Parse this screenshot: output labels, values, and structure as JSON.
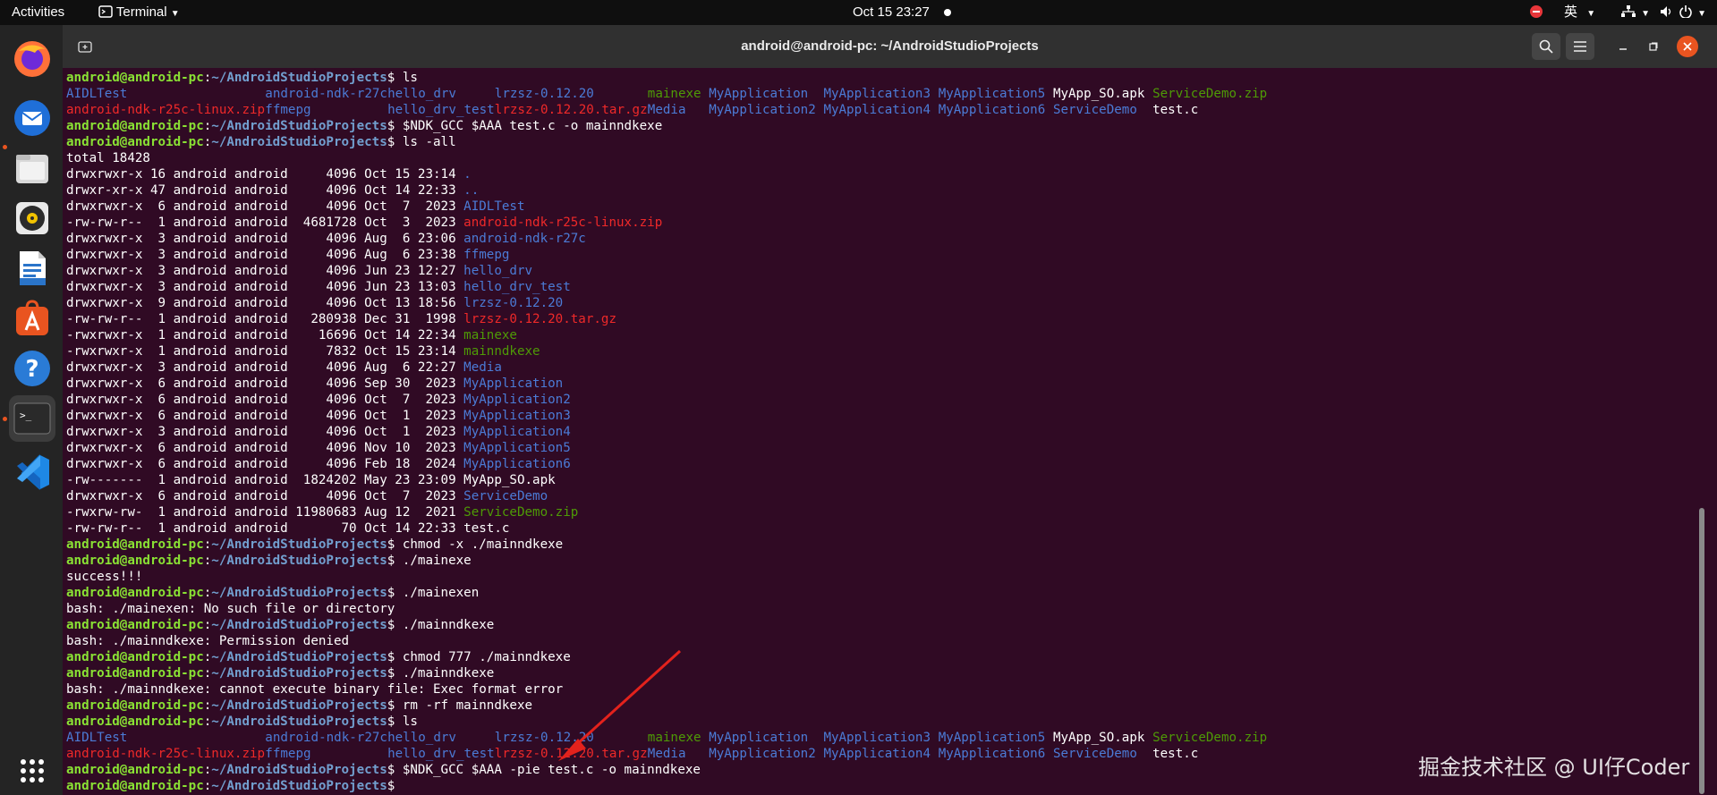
{
  "topbar": {
    "activities": "Activities",
    "app_menu": "Terminal",
    "clock": "Oct 15  23:27",
    "input_method": "英"
  },
  "window": {
    "title": "android@android-pc: ~/AndroidStudioProjects"
  },
  "prompt": {
    "user_host": "android@android-pc",
    "sep": ":",
    "path": "~/AndroidStudioProjects",
    "dollar": "$"
  },
  "terminal_lines": [
    {
      "type": "prompt",
      "cmd": " ls"
    },
    {
      "type": "grid",
      "cells": [
        {
          "t": "AIDLTest",
          "c": "dir"
        },
        {
          "t": "android-ndk-r27c",
          "c": "dir"
        },
        {
          "t": "hello_drv",
          "c": "dir"
        },
        {
          "t": "lrzsz-0.12.20",
          "c": "dir"
        },
        {
          "t": "mainexe",
          "c": "ex"
        },
        {
          "t": "MyApplication",
          "c": "dir"
        },
        {
          "t": "MyApplication3",
          "c": "dir"
        },
        {
          "t": "MyApplication5",
          "c": "dir"
        },
        {
          "t": "MyApp_SO.apk",
          "c": "plain"
        },
        {
          "t": "ServiceDemo.zip",
          "c": "ex"
        }
      ]
    },
    {
      "type": "grid",
      "cells": [
        {
          "t": "android-ndk-r25c-linux.zip",
          "c": "ar"
        },
        {
          "t": "ffmepg",
          "c": "dir"
        },
        {
          "t": "hello_drv_test",
          "c": "dir"
        },
        {
          "t": "lrzsz-0.12.20.tar.gz",
          "c": "ar"
        },
        {
          "t": "Media",
          "c": "dir"
        },
        {
          "t": "MyApplication2",
          "c": "dir"
        },
        {
          "t": "MyApplication4",
          "c": "dir"
        },
        {
          "t": "MyApplication6",
          "c": "dir"
        },
        {
          "t": "ServiceDemo",
          "c": "dir"
        },
        {
          "t": "test.c",
          "c": "plain"
        }
      ]
    },
    {
      "type": "prompt",
      "cmd": " $NDK_GCC $AAA test.c -o mainndkexe"
    },
    {
      "type": "prompt",
      "cmd": " ls -all"
    },
    {
      "type": "text",
      "text": "total 18428"
    },
    {
      "type": "ls",
      "pre": "drwxrwxr-x 16 android android     4096 Oct 15 23:14 ",
      "name": ".",
      "c": "dir"
    },
    {
      "type": "ls",
      "pre": "drwxr-xr-x 47 android android     4096 Oct 14 22:33 ",
      "name": "..",
      "c": "dir"
    },
    {
      "type": "ls",
      "pre": "drwxrwxr-x  6 android android     4096 Oct  7  2023 ",
      "name": "AIDLTest",
      "c": "dir"
    },
    {
      "type": "ls",
      "pre": "-rw-rw-r--  1 android android  4681728 Oct  3  2023 ",
      "name": "android-ndk-r25c-linux.zip",
      "c": "ar"
    },
    {
      "type": "ls",
      "pre": "drwxrwxr-x  3 android android     4096 Aug  6 23:06 ",
      "name": "android-ndk-r27c",
      "c": "dir"
    },
    {
      "type": "ls",
      "pre": "drwxrwxr-x  3 android android     4096 Aug  6 23:38 ",
      "name": "ffmepg",
      "c": "dir"
    },
    {
      "type": "ls",
      "pre": "drwxrwxr-x  3 android android     4096 Jun 23 12:27 ",
      "name": "hello_drv",
      "c": "dir"
    },
    {
      "type": "ls",
      "pre": "drwxrwxr-x  3 android android     4096 Jun 23 13:03 ",
      "name": "hello_drv_test",
      "c": "dir"
    },
    {
      "type": "ls",
      "pre": "drwxrwxr-x  9 android android     4096 Oct 13 18:56 ",
      "name": "lrzsz-0.12.20",
      "c": "dir"
    },
    {
      "type": "ls",
      "pre": "-rw-rw-r--  1 android android   280938 Dec 31  1998 ",
      "name": "lrzsz-0.12.20.tar.gz",
      "c": "ar"
    },
    {
      "type": "ls",
      "pre": "-rwxrwxr-x  1 android android    16696 Oct 14 22:34 ",
      "name": "mainexe",
      "c": "ex"
    },
    {
      "type": "ls",
      "pre": "-rwxrwxr-x  1 android android     7832 Oct 15 23:14 ",
      "name": "mainndkexe",
      "c": "ex"
    },
    {
      "type": "ls",
      "pre": "drwxrwxr-x  3 android android     4096 Aug  6 22:27 ",
      "name": "Media",
      "c": "dir"
    },
    {
      "type": "ls",
      "pre": "drwxrwxr-x  6 android android     4096 Sep 30  2023 ",
      "name": "MyApplication",
      "c": "dir"
    },
    {
      "type": "ls",
      "pre": "drwxrwxr-x  6 android android     4096 Oct  7  2023 ",
      "name": "MyApplication2",
      "c": "dir"
    },
    {
      "type": "ls",
      "pre": "drwxrwxr-x  6 android android     4096 Oct  1  2023 ",
      "name": "MyApplication3",
      "c": "dir"
    },
    {
      "type": "ls",
      "pre": "drwxrwxr-x  3 android android     4096 Oct  1  2023 ",
      "name": "MyApplication4",
      "c": "dir"
    },
    {
      "type": "ls",
      "pre": "drwxrwxr-x  6 android android     4096 Nov 10  2023 ",
      "name": "MyApplication5",
      "c": "dir"
    },
    {
      "type": "ls",
      "pre": "drwxrwxr-x  6 android android     4096 Feb 18  2024 ",
      "name": "MyApplication6",
      "c": "dir"
    },
    {
      "type": "ls",
      "pre": "-rw-------  1 android android  1824202 May 23 23:09 ",
      "name": "MyApp_SO.apk",
      "c": "plain"
    },
    {
      "type": "ls",
      "pre": "drwxrwxr-x  6 android android     4096 Oct  7  2023 ",
      "name": "ServiceDemo",
      "c": "dir"
    },
    {
      "type": "ls",
      "pre": "-rwxrw-rw-  1 android android 11980683 Aug 12  2021 ",
      "name": "ServiceDemo.zip",
      "c": "ex"
    },
    {
      "type": "ls",
      "pre": "-rw-rw-r--  1 android android       70 Oct 14 22:33 ",
      "name": "test.c",
      "c": "plain"
    },
    {
      "type": "prompt",
      "cmd": " chmod -x ./mainndkexe"
    },
    {
      "type": "prompt",
      "cmd": " ./mainexe"
    },
    {
      "type": "text",
      "text": "success!!!"
    },
    {
      "type": "prompt",
      "cmd": " ./mainexen"
    },
    {
      "type": "text",
      "text": "bash: ./mainexen: No such file or directory"
    },
    {
      "type": "prompt",
      "cmd": " ./mainndkexe"
    },
    {
      "type": "text",
      "text": "bash: ./mainndkexe: Permission denied"
    },
    {
      "type": "prompt",
      "cmd": " chmod 777 ./mainndkexe"
    },
    {
      "type": "prompt",
      "cmd": " ./mainndkexe"
    },
    {
      "type": "text",
      "text": "bash: ./mainndkexe: cannot execute binary file: Exec format error"
    },
    {
      "type": "prompt",
      "cmd": " rm -rf mainndkexe"
    },
    {
      "type": "prompt",
      "cmd": " ls"
    },
    {
      "type": "grid",
      "cells": [
        {
          "t": "AIDLTest",
          "c": "dir"
        },
        {
          "t": "android-ndk-r27c",
          "c": "dir"
        },
        {
          "t": "hello_drv",
          "c": "dir"
        },
        {
          "t": "lrzsz-0.12.20",
          "c": "dir"
        },
        {
          "t": "mainexe",
          "c": "ex"
        },
        {
          "t": "MyApplication",
          "c": "dir"
        },
        {
          "t": "MyApplication3",
          "c": "dir"
        },
        {
          "t": "MyApplication5",
          "c": "dir"
        },
        {
          "t": "MyApp_SO.apk",
          "c": "plain"
        },
        {
          "t": "ServiceDemo.zip",
          "c": "ex"
        }
      ]
    },
    {
      "type": "grid",
      "cells": [
        {
          "t": "android-ndk-r25c-linux.zip",
          "c": "ar"
        },
        {
          "t": "ffmepg",
          "c": "dir"
        },
        {
          "t": "hello_drv_test",
          "c": "dir"
        },
        {
          "t": "lrzsz-0.12.20.tar.gz",
          "c": "ar"
        },
        {
          "t": "Media",
          "c": "dir"
        },
        {
          "t": "MyApplication2",
          "c": "dir"
        },
        {
          "t": "MyApplication4",
          "c": "dir"
        },
        {
          "t": "MyApplication6",
          "c": "dir"
        },
        {
          "t": "ServiceDemo",
          "c": "dir"
        },
        {
          "t": "test.c",
          "c": "plain"
        }
      ]
    },
    {
      "type": "prompt",
      "cmd": " $NDK_GCC $AAA -pie test.c -o mainndkexe"
    },
    {
      "type": "prompt",
      "cmd": ""
    }
  ],
  "watermark": "掘金技术社区 @ UI仔Coder",
  "dock_apps": [
    {
      "name": "firefox-icon"
    },
    {
      "name": "thunderbird-icon"
    },
    {
      "name": "files-icon"
    },
    {
      "name": "rhythmbox-icon"
    },
    {
      "name": "writer-icon"
    },
    {
      "name": "app-center-icon"
    },
    {
      "name": "help-icon"
    },
    {
      "name": "terminal-icon"
    },
    {
      "name": "vscode-icon"
    }
  ],
  "colors": {
    "prompt_user": "#8ae234",
    "prompt_path": "#729fcf",
    "directory": "#4b7bd6",
    "executable": "#4e9a06",
    "archive": "#ef2929",
    "arrow": "#e3221c"
  }
}
